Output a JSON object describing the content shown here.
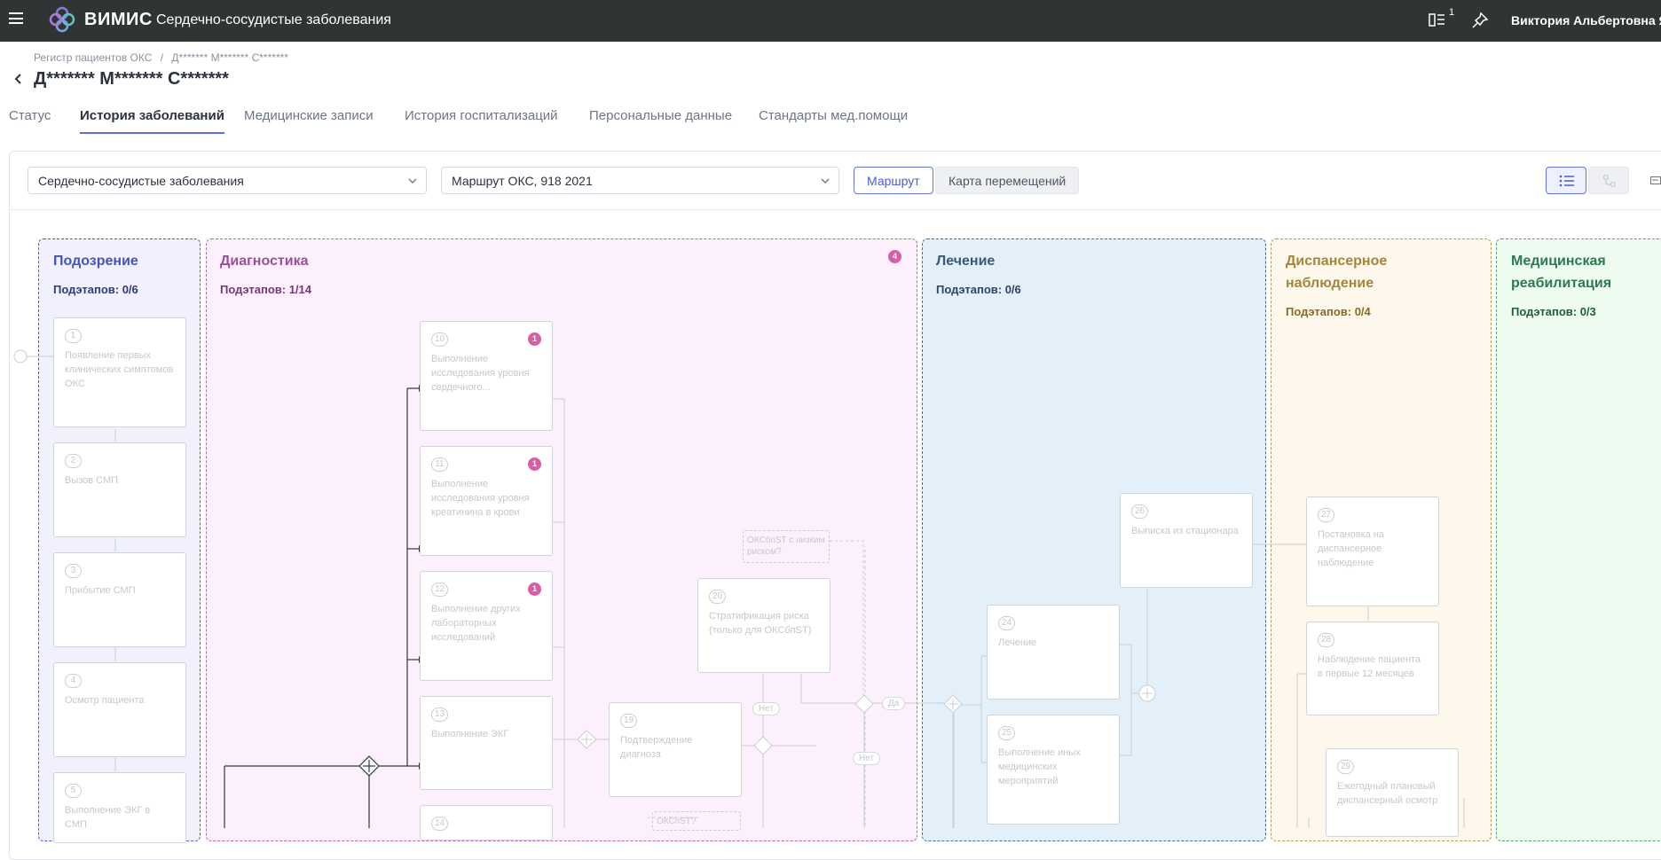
{
  "header": {
    "brand": "ВИМИС",
    "app_title": "Сердечно-сосудистые заболевания",
    "notification_count": "1",
    "user_name": "Виктория Альбертовна Яр"
  },
  "breadcrumb": {
    "items": [
      "Регистр пациентов ОКС",
      "/",
      "Д******* М******* С*******"
    ]
  },
  "patient_name": "Д******* М******* С*******",
  "tabs": [
    {
      "label": "Статус"
    },
    {
      "label": "История заболеваний"
    },
    {
      "label": "Медицинские записи"
    },
    {
      "label": "История госпитализаций"
    },
    {
      "label": "Персональные данные"
    },
    {
      "label": "Стандарты мед.помощи"
    }
  ],
  "toolbar": {
    "disease_select": "Сердечно-сосудистые заболевания",
    "route_select": "Маршрут ОКС, 918 2021",
    "view_route": "Маршрут",
    "view_movement_map": "Карта перемещений"
  },
  "lanes": [
    {
      "title": "Подозрение",
      "sub": "Подэтапов: 0/6"
    },
    {
      "title": "Диагностика",
      "sub": "Подэтапов: 1/14",
      "badge": "4"
    },
    {
      "title": "Лечение",
      "sub": "Подэтапов: 0/6"
    },
    {
      "title": "Диспансерное наблюдение",
      "sub": "Подэтапов: 0/4"
    },
    {
      "title": "Медицинская реабилитация",
      "sub": "Подэтапов: 0/3"
    }
  ],
  "steps": {
    "s1": {
      "num": "1",
      "text": "Появление первых клинических симптомов ОКС"
    },
    "s2": {
      "num": "2",
      "text": "Вызов СМП"
    },
    "s3": {
      "num": "3",
      "text": "Прибытие СМП"
    },
    "s4": {
      "num": "4",
      "text": "Осмотр пациента"
    },
    "s5": {
      "num": "5",
      "text": "Выполнение ЭКГ в СМП"
    },
    "s10": {
      "num": "10",
      "text": "Выполнение исследования уровня сердечного...",
      "badge": "1"
    },
    "s11": {
      "num": "11",
      "text": "Выполнение исследования уровня креатинина в крови",
      "badge": "1"
    },
    "s12": {
      "num": "12",
      "text": "Выполнение других лабораторных исследований",
      "badge": "1"
    },
    "s13": {
      "num": "13",
      "text": "Выполнение ЭКГ"
    },
    "s14": {
      "num": "14",
      "text": ""
    },
    "s19": {
      "num": "19",
      "text": "Подтверждение диагноза"
    },
    "s20": {
      "num": "20",
      "text": "Стратификация риска (только для ОКСбпST)"
    },
    "s24": {
      "num": "24",
      "text": "Лечение"
    },
    "s25": {
      "num": "25",
      "text": "Выполнение иных медицинских мероприятий"
    },
    "s26": {
      "num": "26",
      "text": "Выписка из стационара"
    },
    "s27": {
      "num": "27",
      "text": "Постановка на диспансерное наблюдение"
    },
    "s28": {
      "num": "28",
      "text": "Наблюдение пациента в первые 12 месяцев"
    },
    "s29": {
      "num": "29",
      "text": "Ежегодный плановый диспансерный осмотр"
    }
  },
  "notes": {
    "n1": "ОКСбпST с низким риском?",
    "n2": "ОКСпST?"
  },
  "pills": {
    "no1": "Нет",
    "no2": "Нет",
    "yes": "Да"
  },
  "colors": {
    "topbar": "#2f3435",
    "accent": "#5e6ed6",
    "badge": "#d85fa4"
  }
}
